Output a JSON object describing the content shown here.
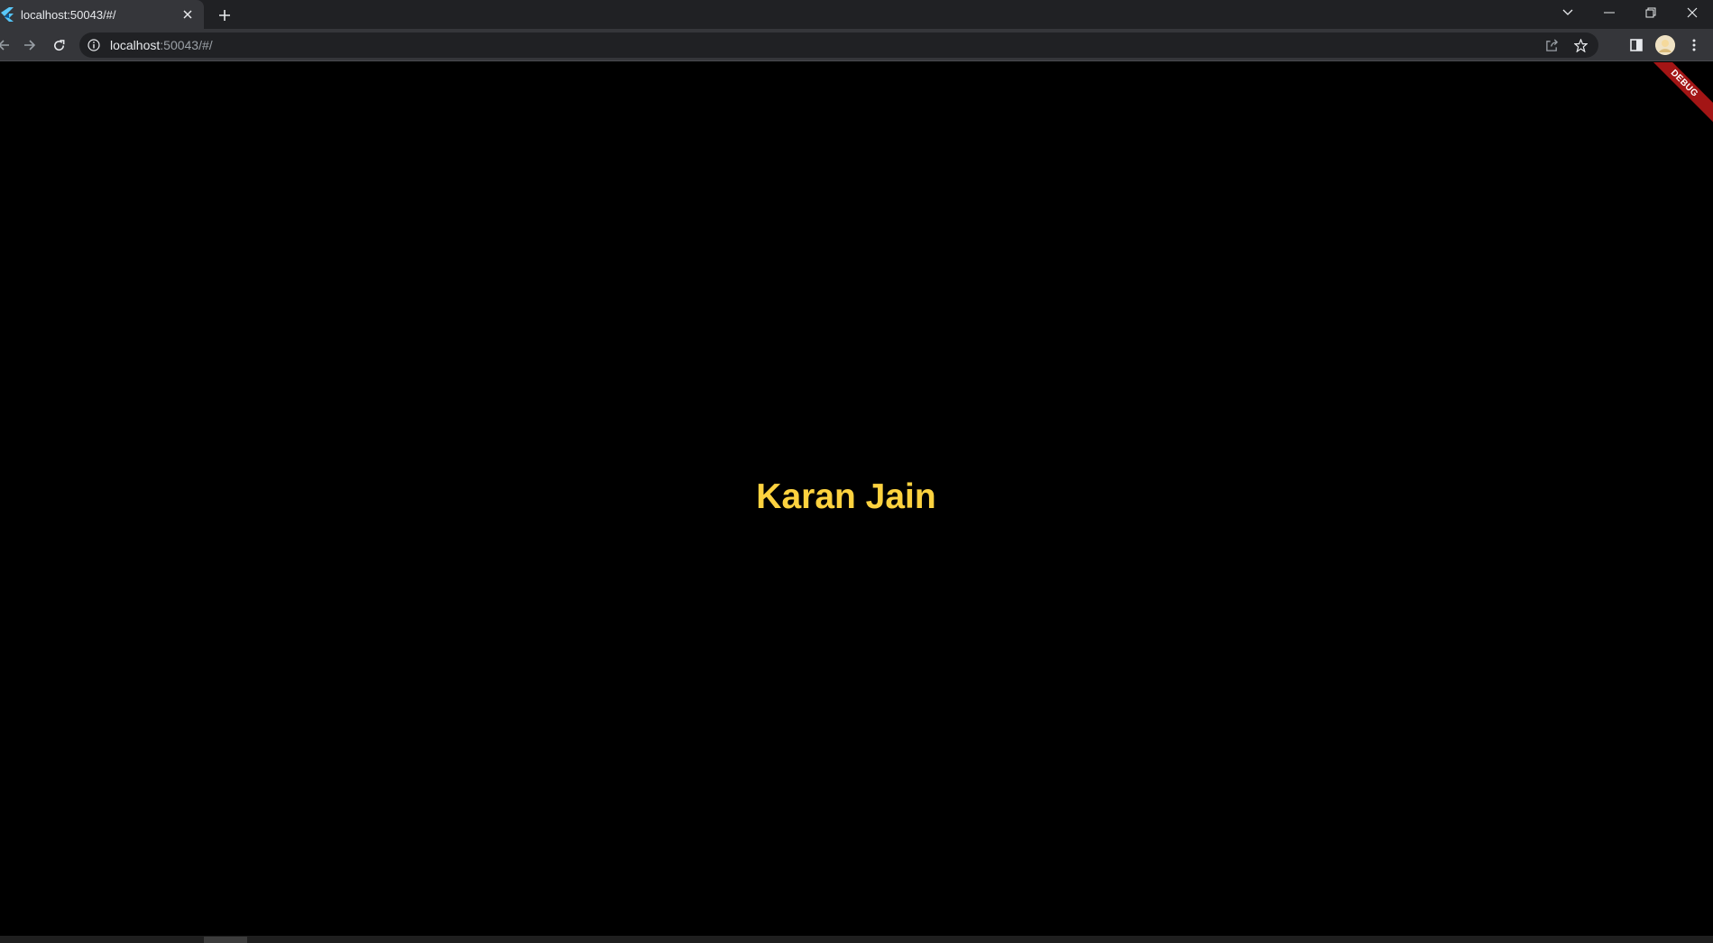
{
  "tab": {
    "title": "localhost:50043/#/",
    "favicon": "flutter-icon"
  },
  "toolbar": {
    "url_host": "localhost",
    "url_rest": ":50043/#/"
  },
  "page": {
    "heading": "Karan Jain",
    "heading_color": "#fdd23f",
    "debug_banner": "DEBUG"
  },
  "colors": {
    "page_background": "#000000",
    "tabstrip": "#202124",
    "toolbar": "#35363a",
    "banner": "#a31515"
  }
}
